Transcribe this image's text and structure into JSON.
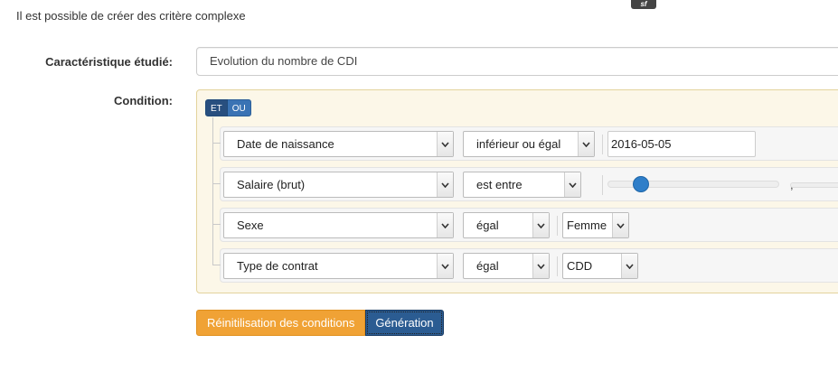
{
  "intro_text": "Il est possible de créer des critère complexe",
  "logo_text": "sf",
  "characteristic": {
    "label": "Caractéristique étudié:",
    "value": "Evolution du nombre de CDI"
  },
  "condition": {
    "label": "Condition:",
    "conjunction_and": "ET",
    "conjunction_or": "OU",
    "rules": [
      {
        "field": "Date de naissance",
        "operator": "inférieur ou égal",
        "value": "2016-05-05"
      },
      {
        "field": "Salaire (brut)",
        "operator": "est entre",
        "value_separator": ","
      },
      {
        "field": "Sexe",
        "operator": "égal",
        "value": "Femme"
      },
      {
        "field": "Type de contrat",
        "operator": "égal",
        "value": "CDD"
      }
    ]
  },
  "actions": {
    "reset_label": "Réinitilisation des conditions",
    "generate_label": "Génération"
  }
}
